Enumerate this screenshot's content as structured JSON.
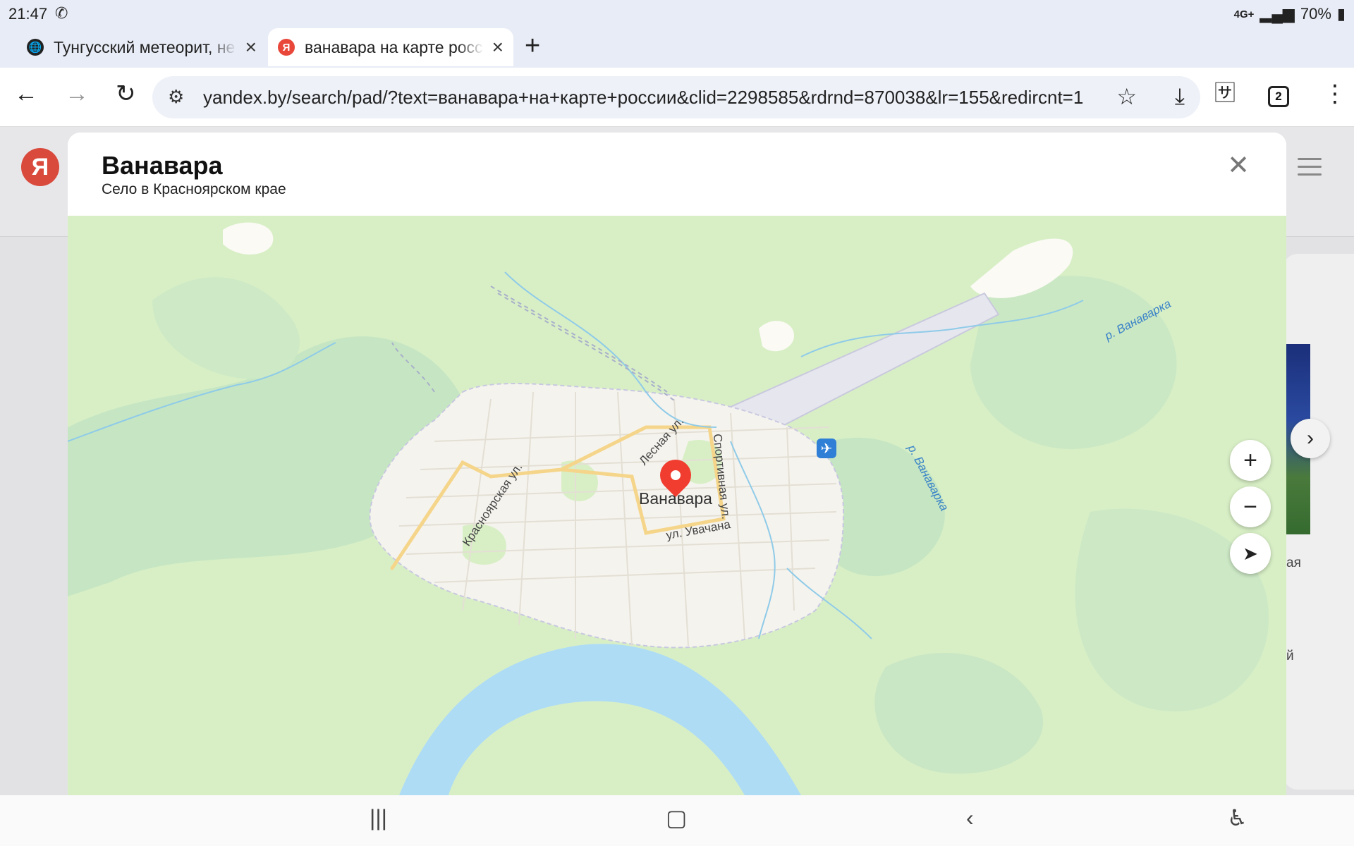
{
  "status_bar": {
    "time": "21:47",
    "call_icon": "phone-call-icon",
    "network": "4G+",
    "battery": "70%"
  },
  "tabs": [
    {
      "title": "Тунгусский метеорит, не",
      "favicon": "globe-icon",
      "active": false
    },
    {
      "title": "ванавара на карте росс",
      "favicon": "Я",
      "active": true
    }
  ],
  "new_tab_label": "+",
  "toolbar": {
    "url": "yandex.by/search/pad/?text=ванавара+на+карте+россии&clid=2298585&rdrnd=870038&lr=155&redircnt=1",
    "tab_count": "2"
  },
  "page": {
    "logo_letter": "Я",
    "side_text_1": "ая",
    "side_text_2": "й"
  },
  "popup": {
    "title": "Ванавара",
    "subtitle": "Село в Красноярском крае"
  },
  "map": {
    "place_label": "Ванавара",
    "streets": [
      "Лесная ул.",
      "Спортивная ул.",
      "Красноярская ул.",
      "ул. Увачана"
    ],
    "river_labels": [
      "р. Ванаварка",
      "р. Ванаварка"
    ],
    "controls": [
      "zoom-in",
      "zoom-out",
      "my-location"
    ],
    "colors": {
      "forest": "#d8efc6",
      "forest_dark": "#c4e4c1",
      "water": "#aedcf5",
      "town": "#f5f3ee",
      "road": "#f7d98c",
      "airport": "#e8e8f0",
      "pin": "#f03d2f"
    }
  }
}
